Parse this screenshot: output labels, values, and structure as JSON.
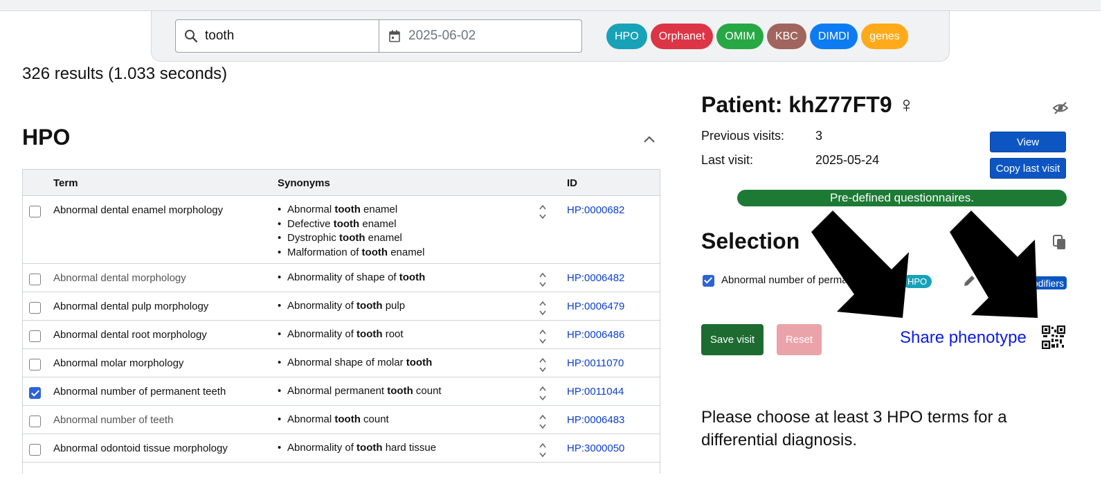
{
  "search": {
    "query": "tooth",
    "date": "2025-06-02",
    "sources": [
      {
        "label": "HPO",
        "color": "#17a2b8"
      },
      {
        "label": "Orphanet",
        "color": "#dc3545"
      },
      {
        "label": "OMIM",
        "color": "#28a745"
      },
      {
        "label": "KBC",
        "color": "#a0655e"
      },
      {
        "label": "DIMDI",
        "color": "#0d7bf2"
      },
      {
        "label": "genes",
        "color": "#ffaa1a"
      }
    ]
  },
  "results": {
    "summary": "326 results (1.033 seconds)"
  },
  "hpo_section": {
    "title": "HPO",
    "columns": {
      "term": "Term",
      "synonyms": "Synonyms",
      "id": "ID"
    },
    "rows": [
      {
        "term": "Abnormal dental enamel morphology",
        "checked": false,
        "muted": false,
        "synonyms": [
          [
            "Abnormal ",
            "tooth",
            " enamel"
          ],
          [
            "Defective ",
            "tooth",
            " enamel"
          ],
          [
            "Dystrophic ",
            "tooth",
            " enamel"
          ],
          [
            "Malformation of ",
            "tooth",
            " enamel"
          ]
        ],
        "id": "HP:0000682"
      },
      {
        "term": "Abnormal dental morphology",
        "checked": false,
        "muted": true,
        "synonyms": [
          [
            "Abnormality of shape of ",
            "tooth",
            ""
          ]
        ],
        "id": "HP:0006482"
      },
      {
        "term": "Abnormal dental pulp morphology",
        "checked": false,
        "muted": false,
        "synonyms": [
          [
            "Abnormality of ",
            "tooth",
            " pulp"
          ]
        ],
        "id": "HP:0006479"
      },
      {
        "term": "Abnormal dental root morphology",
        "checked": false,
        "muted": false,
        "synonyms": [
          [
            "Abnormality of ",
            "tooth",
            " root"
          ]
        ],
        "id": "HP:0006486"
      },
      {
        "term": "Abnormal molar morphology",
        "checked": false,
        "muted": false,
        "synonyms": [
          [
            "Abnormal shape of molar ",
            "tooth",
            ""
          ]
        ],
        "id": "HP:0011070"
      },
      {
        "term": "Abnormal number of permanent teeth",
        "checked": true,
        "muted": false,
        "synonyms": [
          [
            "Abnormal permanent ",
            "tooth",
            " count"
          ]
        ],
        "id": "HP:0011044"
      },
      {
        "term": "Abnormal number of teeth",
        "checked": false,
        "muted": true,
        "synonyms": [
          [
            "Abnormal ",
            "tooth",
            " count"
          ]
        ],
        "id": "HP:0006483"
      },
      {
        "term": "Abnormal odontoid tissue morphology",
        "checked": false,
        "muted": false,
        "synonyms": [
          [
            "Abnormality of ",
            "tooth",
            " hard tissue"
          ]
        ],
        "id": "HP:3000050"
      }
    ]
  },
  "patient": {
    "title": "Patient: khZ77FT9 ♀",
    "previous_visits_label": "Previous visits:",
    "previous_visits_value": "3",
    "last_visit_label": "Last visit:",
    "last_visit_value": "2025-05-24",
    "view_label": "View",
    "copy_last_visit_label": "Copy last visit",
    "questionnaires_label": "Pre-defined questionnaires."
  },
  "selection": {
    "title": "Selection",
    "item_term": "Abnormal number of permanent teeth",
    "item_badge": "HPO",
    "modifiers_label": "Modifiers",
    "save_label": "Save visit",
    "reset_label": "Reset",
    "share_label": "Share phenotype",
    "hint": "Please choose at least 3 HPO terms for a differential diagnosis."
  }
}
